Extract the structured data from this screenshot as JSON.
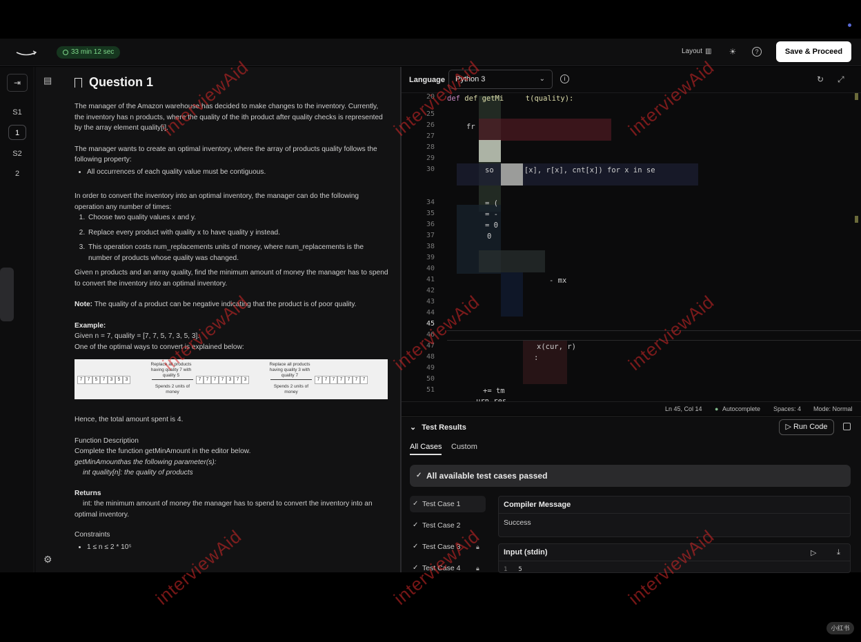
{
  "header": {
    "timer": "33 min 12 sec",
    "layout_label": "Layout",
    "save_label": "Save & Proceed"
  },
  "rail": {
    "items": [
      "S1",
      "1",
      "S2",
      "2"
    ]
  },
  "question": {
    "title": "Question 1",
    "p1": "The manager of the Amazon warehouse has decided to make changes to the inventory. Currently, the inventory has n products, where the quality of the ith product after quality checks is represented by the array element quality[i].",
    "p2": "The manager wants to create an optimal inventory, where the array of products quality follows the following property:",
    "bullet1": "All occurrences of each quality value must be contiguous.",
    "p3": "In order to convert the inventory into an optimal inventory, the manager can do the following operation any number of times:",
    "steps": [
      "Choose two quality values x and y.",
      "Replace every product with quality x to have quality y instead.",
      "This operation costs num_replacements units of money, where num_replacements is the number of products whose quality was changed."
    ],
    "p4": "Given n products and an array quality, find the minimum amount of money the manager has to spend to convert the inventory into an optimal inventory.",
    "note_label": "Note:",
    "note": "The quality of a product can be negative indicating that the product is of poor quality.",
    "example_label": "Example:",
    "example_given": "Given n = 7, quality = [7, 7, 5, 7, 3, 5, 3].",
    "example_line2": "One of the optimal ways to convert is explained below:",
    "diagram": {
      "row1": [
        "7",
        "7",
        "5",
        "7",
        "3",
        "5",
        "3"
      ],
      "row2": [
        "7",
        "7",
        "7",
        "7",
        "3",
        "7",
        "3"
      ],
      "row3": [
        "7",
        "7",
        "7",
        "7",
        "7",
        "7",
        "7"
      ],
      "cap1": "Replace all products having quality 7 with quality 5",
      "cap2": "Replace all products having quality 3 with quality 7",
      "cost1": "Spends 2 units of money",
      "cost2": "Spends 2 units of money"
    },
    "hence": "Hence, the total amount spent is 4.",
    "fd_label": "Function Description",
    "fd_line1": "Complete the function getMinAmount in the editor below.",
    "fd_line2": "getMinAmounthas the following parameter(s):",
    "fd_param": "int quality[n]:  the quality of products",
    "returns_label": "Returns",
    "returns_text": "int: the minimum amount of money the manager has to spend to convert the inventory into an optimal inventory.",
    "constraints_label": "Constraints",
    "constraint1": "1 ≤ n ≤ 2 * 10⁵"
  },
  "editor": {
    "language_label": "Language",
    "language_value": "Python 3",
    "line_numbers": [
      "20",
      "25",
      "26",
      "27",
      "28",
      "29",
      "30",
      "34",
      "35",
      "36",
      "37",
      "38",
      "39",
      "40",
      "41",
      "42",
      "43",
      "44",
      "45",
      "46",
      "47",
      "48",
      "49",
      "50",
      "51"
    ],
    "current_line": "45",
    "code": {
      "l20": "def getMi     t(quality):",
      "l26": "fr",
      "l30": "so       [x], r[x], cnt[x]) for x in se",
      "l33": "= (",
      "l33b": "= -",
      "l35": "= 0",
      "l36": "0",
      "l40": "- mx",
      "l46": "x(cur, r)",
      "l47": ":",
      "l50": "+= tm",
      "l51": "urn res"
    },
    "status": {
      "position": "Ln 45, Col 14",
      "autocomplete": "Autocomplete",
      "spaces": "Spaces: 4",
      "mode": "Mode: Normal"
    }
  },
  "results": {
    "title": "Test Results",
    "run_label": "Run Code",
    "tabs": [
      "All Cases",
      "Custom"
    ],
    "banner": "All available test cases passed",
    "cases": [
      "Test Case 1",
      "Test Case 2",
      "Test Case 3",
      "Test Case 4"
    ],
    "compiler_title": "Compiler Message",
    "compiler_text": "Success",
    "input_title": "Input (stdin)",
    "input_line_no": "1",
    "input_value": "5"
  },
  "watermark_text": "interviewAid",
  "corner_badge": "小红书"
}
